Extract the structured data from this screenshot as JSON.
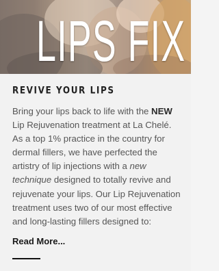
{
  "hero": {
    "title": "LIPS FIX"
  },
  "article": {
    "heading": "REVIVE YOUR LIPS",
    "body": {
      "p1": "Bring your lips back to life with the ",
      "bold": "NEW",
      "p2": " Lip Rejuvenation treatment at La Chelé. As a top 1% practice in the country for dermal fillers, we have perfected the artistry of lip injections with a ",
      "italic": "new technique",
      "p3": " designed to totally revive and rejuvenate your lips. Our Lip Rejuvenation treatment uses two of our most effective and long-lasting fillers designed to:"
    },
    "read_more": "Read More..."
  }
}
